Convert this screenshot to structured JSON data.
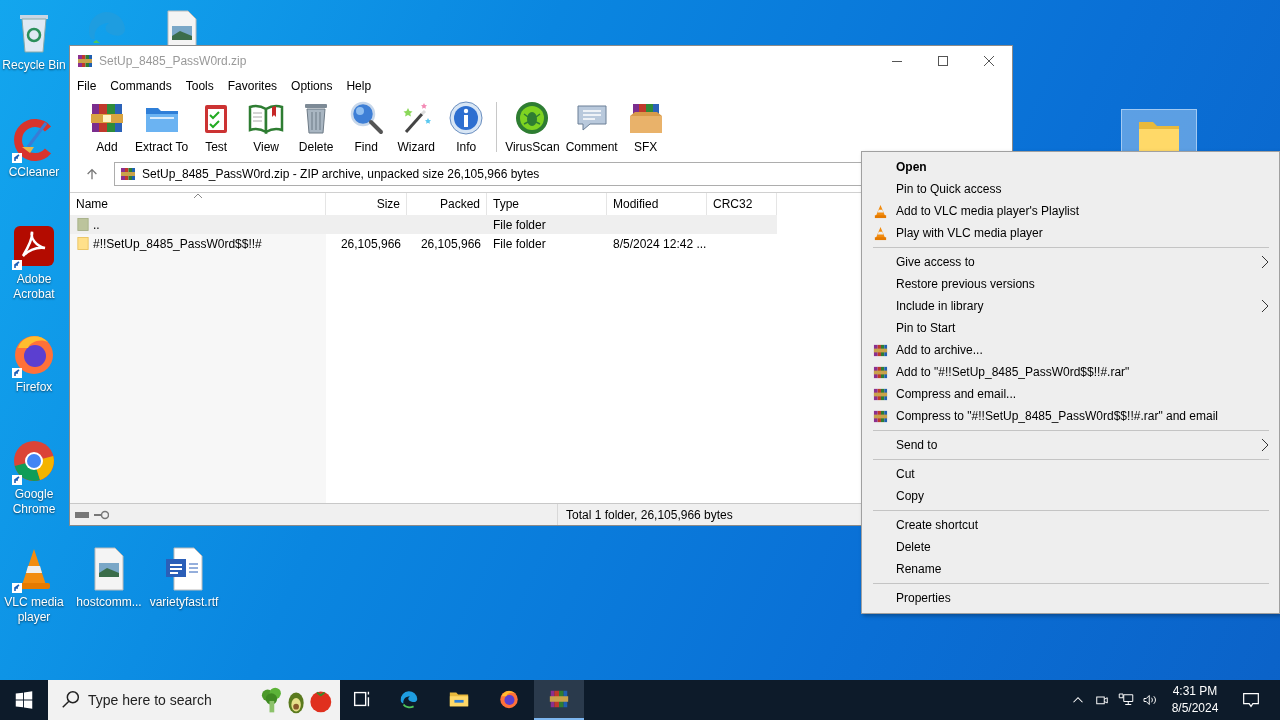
{
  "desktop": {
    "icons": [
      {
        "kind": "recycle",
        "label": "Recycle Bin",
        "shortcut": false,
        "selected": false
      },
      {
        "kind": "ccleaner",
        "label": "CCleaner",
        "shortcut": true,
        "selected": false
      },
      {
        "kind": "acrobat",
        "label": "Adobe Acrobat",
        "shortcut": true,
        "selected": false
      },
      {
        "kind": "firefox",
        "label": "Firefox",
        "shortcut": true,
        "selected": false
      },
      {
        "kind": "chrome",
        "label": "Google Chrome",
        "shortcut": true,
        "selected": false
      },
      {
        "kind": "vlc",
        "label": "VLC media player",
        "shortcut": true,
        "selected": false
      },
      {
        "kind": "image",
        "label": "hostcomm...",
        "shortcut": false,
        "selected": false
      },
      {
        "kind": "word",
        "label": "varietyfast.rtf",
        "shortcut": false,
        "selected": false
      },
      {
        "kind": "edge",
        "selected": false
      },
      {
        "kind": "image",
        "selected": false
      },
      {
        "kind": "folder",
        "selected": true
      }
    ]
  },
  "window": {
    "title": "SetUp_8485_PassW0rd.zip",
    "active": false,
    "menu": [
      "File",
      "Commands",
      "Tools",
      "Favorites",
      "Options",
      "Help"
    ],
    "toolbar": {
      "groups": [
        [
          {
            "label": "Add",
            "kind": "add"
          },
          {
            "label": "Extract To",
            "kind": "extract"
          },
          {
            "label": "Test",
            "kind": "test"
          },
          {
            "label": "View",
            "kind": "view"
          },
          {
            "label": "Delete",
            "kind": "delete"
          },
          {
            "label": "Find",
            "kind": "find"
          },
          {
            "label": "Wizard",
            "kind": "wizard"
          },
          {
            "label": "Info",
            "kind": "info"
          }
        ],
        [
          {
            "label": "VirusScan",
            "kind": "virus"
          },
          {
            "label": "Comment",
            "kind": "comment"
          },
          {
            "label": "SFX",
            "kind": "sfx"
          }
        ]
      ]
    },
    "path": "SetUp_8485_PassW0rd.zip - ZIP archive, unpacked size 26,105,966 bytes",
    "table": {
      "columns": [
        {
          "label": "Name",
          "sorted": true
        },
        {
          "label": "Size",
          "sorted": false
        },
        {
          "label": "Packed",
          "sorted": false
        },
        {
          "label": "Type",
          "sorted": false
        },
        {
          "label": "Modified",
          "sorted": false
        },
        {
          "label": "CRC32",
          "sorted": false
        }
      ],
      "rows": [
        {
          "kind": "parent",
          "selected": true,
          "name": "..",
          "type": "File folder"
        },
        {
          "kind": "folder",
          "selected": false,
          "name": "#!!SetUp_8485_PassW0rd$$!!#",
          "size": "26,105,966",
          "packed": "26,105,966",
          "type": "File folder",
          "modified": "8/5/2024 12:42 ..."
        }
      ]
    },
    "status_bar": "Total 1 folder, 26,105,966 bytes"
  },
  "context_menu": {
    "groups": [
      [
        {
          "label": "Open",
          "bold": true,
          "kind": "plain",
          "submenu": false
        },
        {
          "label": "Pin to Quick access",
          "bold": false,
          "kind": "plain",
          "submenu": false
        },
        {
          "label": "Add to VLC media player's Playlist",
          "bold": false,
          "kind": "vlc",
          "submenu": false
        },
        {
          "label": "Play with VLC media player",
          "bold": false,
          "kind": "vlc",
          "submenu": false
        }
      ],
      [
        {
          "label": "Give access to",
          "bold": false,
          "kind": "plain",
          "submenu": true
        },
        {
          "label": "Restore previous versions",
          "bold": false,
          "kind": "plain",
          "submenu": false
        },
        {
          "label": "Include in library",
          "bold": false,
          "kind": "plain",
          "submenu": true
        },
        {
          "label": "Pin to Start",
          "bold": false,
          "kind": "plain",
          "submenu": false
        },
        {
          "label": "Add to archive...",
          "bold": false,
          "kind": "winrar",
          "submenu": false
        },
        {
          "label": "Add to \"#!!SetUp_8485_PassW0rd$$!!#.rar\"",
          "bold": false,
          "kind": "winrar",
          "submenu": false
        },
        {
          "label": "Compress and email...",
          "bold": false,
          "kind": "winrar",
          "submenu": false
        },
        {
          "label": "Compress to \"#!!SetUp_8485_PassW0rd$$!!#.rar\" and email",
          "bold": false,
          "kind": "winrar",
          "submenu": false
        }
      ],
      [
        {
          "label": "Send to",
          "bold": false,
          "kind": "plain",
          "submenu": true
        }
      ],
      [
        {
          "label": "Cut",
          "bold": false,
          "kind": "plain",
          "submenu": false
        },
        {
          "label": "Copy",
          "bold": false,
          "kind": "plain",
          "submenu": false
        }
      ],
      [
        {
          "label": "Create shortcut",
          "bold": false,
          "kind": "plain",
          "submenu": false
        },
        {
          "label": "Delete",
          "bold": false,
          "kind": "plain",
          "submenu": false
        },
        {
          "label": "Rename",
          "bold": false,
          "kind": "plain",
          "submenu": false
        }
      ],
      [
        {
          "label": "Properties",
          "bold": false,
          "kind": "plain",
          "submenu": false
        }
      ]
    ]
  },
  "taskbar": {
    "search": {
      "placeholder": "Type here to search"
    },
    "apps": [
      {
        "kind": "taskview",
        "active": false
      },
      {
        "kind": "edge",
        "active": false
      },
      {
        "kind": "explorer",
        "active": false
      },
      {
        "kind": "firefox",
        "active": false
      },
      {
        "kind": "winrar",
        "active": true
      }
    ],
    "clock": {
      "time": "4:31 PM",
      "date": "8/5/2024"
    }
  }
}
